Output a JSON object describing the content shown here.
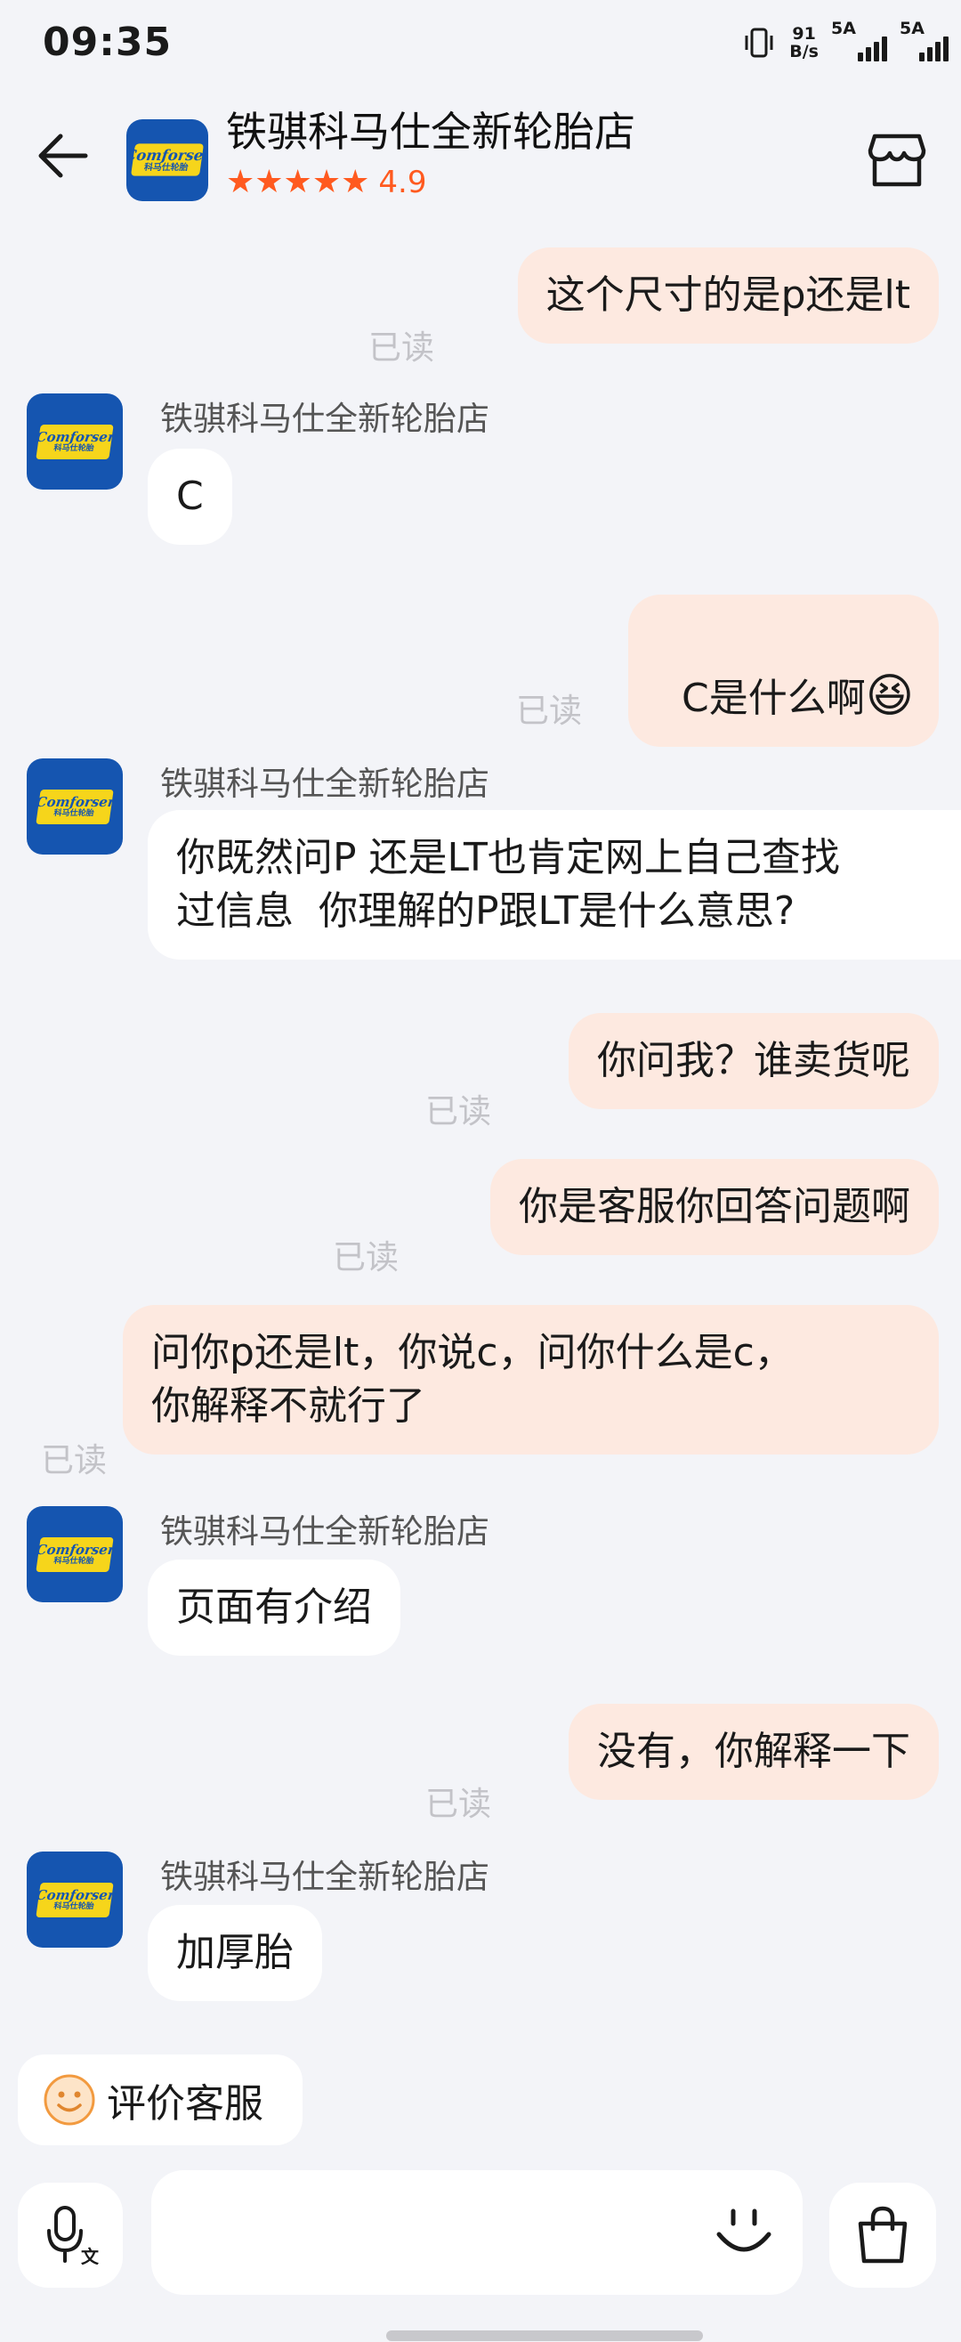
{
  "status_bar": {
    "time": "09:35",
    "net_speed_value": "91",
    "net_speed_unit": "B/s",
    "sim1_label": "5A",
    "sim2_label": "5A"
  },
  "header": {
    "shop_name": "铁骐科马仕全新轮胎店",
    "stars": "★★★★★",
    "rating": "4.9",
    "logo_text_1": "Comforser",
    "logo_text_2": "科马仕轮胎"
  },
  "messages": [
    {
      "from": "me",
      "text": "这个尺寸的是p还是lt",
      "read": "已读"
    },
    {
      "from": "shop",
      "sender": "铁骐科马仕全新轮胎店",
      "text": "C"
    },
    {
      "from": "me",
      "text": "C是什么啊",
      "emoji": "😆",
      "read": "已读"
    },
    {
      "from": "shop",
      "sender": "铁骐科马仕全新轮胎店",
      "text": "你既然问P 还是LT也肯定网上自己查找\n过信息  你理解的P跟LT是什么意思?"
    },
    {
      "from": "me",
      "text": "你问我？谁卖货呢",
      "read": "已读"
    },
    {
      "from": "me",
      "text": "你是客服你回答问题啊",
      "read": "已读"
    },
    {
      "from": "me",
      "text": "问你p还是lt，你说c，问你什么是c，\n你解释不就行了",
      "read": "已读"
    },
    {
      "from": "shop",
      "sender": "铁骐科马仕全新轮胎店",
      "text": "页面有介绍"
    },
    {
      "from": "me",
      "text": "没有，你解释一下",
      "read": "已读"
    },
    {
      "from": "shop",
      "sender": "铁骐科马仕全新轮胎店",
      "text": "加厚胎"
    }
  ],
  "bottom": {
    "eval_label": "评价客服",
    "input_placeholder": ""
  },
  "colors": {
    "background": "#f3f4f8",
    "my_bubble": "#fde9e0",
    "shop_bubble": "#ffffff",
    "accent": "#ff5a1f",
    "logo_blue": "#1555b0",
    "logo_yellow": "#f6d51b"
  }
}
